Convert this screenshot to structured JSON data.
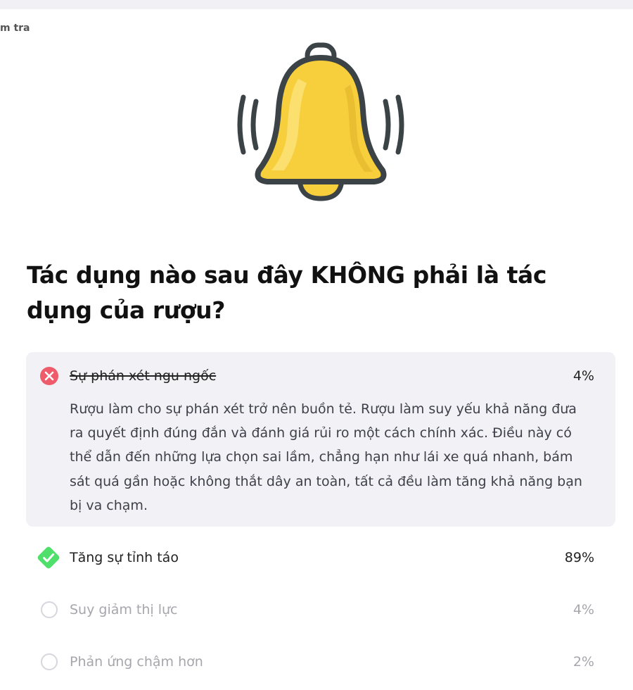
{
  "breadcrumb": "m tra",
  "icon": "bell-ringing-icon",
  "colors": {
    "bell_fill": "#f7cf3c",
    "bell_outline": "#3c4347",
    "wrong": "#ef5b6b",
    "correct": "#4ee06b",
    "answer_box": "#f2f2f6",
    "muted_text": "#a6a6ad"
  },
  "question": "Tác dụng nào sau đây KHÔNG phải là tác dụng của rượu?",
  "options": [
    {
      "label": "Sự phán xét ngu ngốc",
      "percent": "4%",
      "state": "selected-wrong",
      "icon": "x-circle-icon",
      "explanation": "Rượu làm cho sự phán xét trở nên buồn tẻ. Rượu làm suy yếu khả năng đưa ra quyết định đúng đắn và đánh giá rủi ro một cách chính xác. Điều này có thể dẫn đến những lựa chọn sai lầm, chẳng hạn như lái xe quá nhanh, bám sát quá gần hoặc không thắt dây an toàn, tất cả đều làm tăng khả năng bạn bị va chạm."
    },
    {
      "label": "Tăng sự tỉnh táo",
      "percent": "89%",
      "state": "correct",
      "icon": "check-diamond-icon"
    },
    {
      "label": "Suy giảm thị lực",
      "percent": "4%",
      "state": "unselected",
      "icon": "empty-circle-icon"
    },
    {
      "label": "Phản ứng chậm hơn",
      "percent": "2%",
      "state": "unselected",
      "icon": "empty-circle-icon"
    }
  ]
}
